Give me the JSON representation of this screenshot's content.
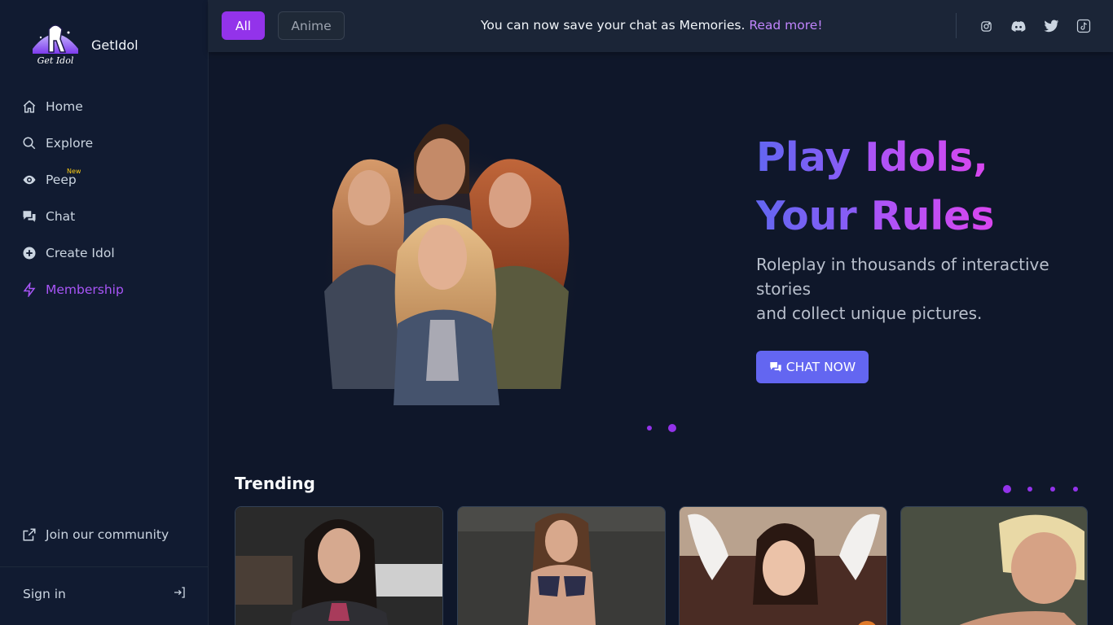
{
  "brand": {
    "name": "GetIdol",
    "logo_text": "Get Idol"
  },
  "sidebar": {
    "items": [
      {
        "label": "Home",
        "icon": "home-icon"
      },
      {
        "label": "Explore",
        "icon": "search-icon"
      },
      {
        "label": "Peep",
        "icon": "eye-icon",
        "badge": "New"
      },
      {
        "label": "Chat",
        "icon": "chat-bubbles-icon"
      },
      {
        "label": "Create Idol",
        "icon": "plus-circle-icon"
      },
      {
        "label": "Membership",
        "icon": "lightning-icon",
        "active": true
      }
    ],
    "community_label": "Join our community",
    "signin_label": "Sign in"
  },
  "topbar": {
    "filters": [
      {
        "label": "All",
        "selected": true
      },
      {
        "label": "Anime",
        "selected": false
      }
    ],
    "announcement": "You can now save your chat as Memories.",
    "announcement_link": "Read more!",
    "social_icons": [
      "instagram-icon",
      "discord-icon",
      "twitter-icon",
      "tiktok-icon"
    ]
  },
  "hero": {
    "title_line1_a": "Play",
    "title_line1_b": "Idols,",
    "title_line2_a": "Your",
    "title_line2_b": "Rules",
    "subtitle_line1": "Roleplay in thousands of interactive stories",
    "subtitle_line2": "and collect unique pictures.",
    "cta_label": "CHAT NOW",
    "slide_count": 2,
    "active_slide": 2
  },
  "trending": {
    "title": "Trending",
    "page_count": 4,
    "active_page": 1
  },
  "colors": {
    "background": "#0f172a",
    "sidebar": "#111b31",
    "accent_purple": "#9333ea",
    "accent_indigo": "#6366f1",
    "membership": "#a855f7"
  }
}
